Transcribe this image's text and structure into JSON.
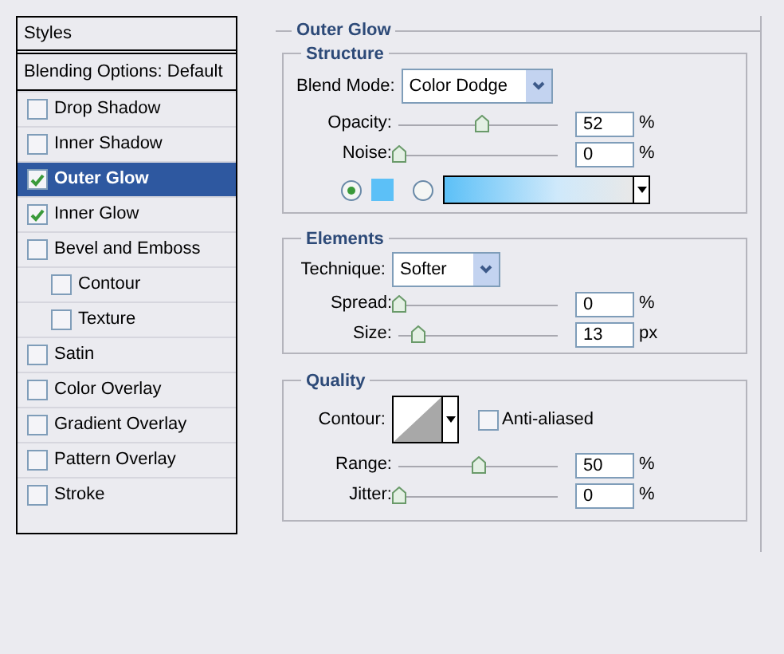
{
  "styles_panel": {
    "title": "Styles",
    "blending_options": "Blending Options: Default",
    "items": [
      {
        "label": "Drop Shadow",
        "checked": false,
        "selected": false
      },
      {
        "label": "Inner Shadow",
        "checked": false,
        "selected": false
      },
      {
        "label": "Outer Glow",
        "checked": true,
        "selected": true
      },
      {
        "label": "Inner Glow",
        "checked": true,
        "selected": false
      },
      {
        "label": "Bevel and Emboss",
        "checked": false,
        "selected": false,
        "children": [
          {
            "label": "Contour",
            "checked": false,
            "selected": false
          },
          {
            "label": "Texture",
            "checked": false,
            "selected": false
          }
        ]
      },
      {
        "label": "Satin",
        "checked": false,
        "selected": false
      },
      {
        "label": "Color Overlay",
        "checked": false,
        "selected": false
      },
      {
        "label": "Gradient Overlay",
        "checked": false,
        "selected": false
      },
      {
        "label": "Pattern Overlay",
        "checked": false,
        "selected": false
      },
      {
        "label": "Stroke",
        "checked": false,
        "selected": false
      }
    ]
  },
  "outer_glow": {
    "title": "Outer Glow",
    "structure": {
      "title": "Structure",
      "blend_mode": {
        "label": "Blend Mode:",
        "value": "Color Dodge"
      },
      "sliders": [
        {
          "label": "Opacity:",
          "level": 0.52,
          "value": "52",
          "unit": "%"
        },
        {
          "label": "Noise:",
          "level": 0,
          "value": "0",
          "unit": "%"
        }
      ],
      "fill_options": [
        {
          "kind": "color",
          "selected": true
        },
        {
          "kind": "gradient",
          "selected": false
        }
      ]
    },
    "elements": {
      "title": "Elements",
      "technique": {
        "label": "Technique:",
        "value": "Softer"
      },
      "sliders": [
        {
          "label": "Spread:",
          "level": 0,
          "value": "0",
          "unit": "%"
        },
        {
          "label": "Size:",
          "level": 0.12,
          "value": "13",
          "unit": "px"
        }
      ]
    },
    "quality": {
      "title": "Quality",
      "contour": {
        "label": "Contour:"
      },
      "anti_aliased": {
        "label": "Anti-aliased",
        "checked": false
      },
      "sliders": [
        {
          "label": "Range:",
          "level": 0.5,
          "value": "50",
          "unit": "%"
        },
        {
          "label": "Jitter:",
          "level": 0,
          "value": "0",
          "unit": "%"
        }
      ]
    }
  }
}
